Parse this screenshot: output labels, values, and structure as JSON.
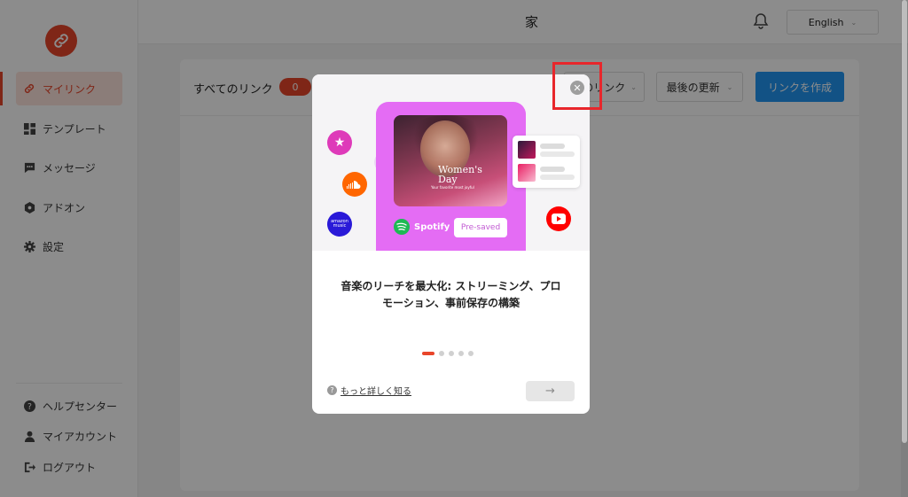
{
  "sidebar": {
    "items": [
      {
        "label": "マイリンク",
        "icon": "link-icon"
      },
      {
        "label": "テンプレート",
        "icon": "grid-icon"
      },
      {
        "label": "メッセージ",
        "icon": "chat-icon"
      },
      {
        "label": "アドオン",
        "icon": "addon-icon"
      },
      {
        "label": "設定",
        "icon": "gear-icon"
      }
    ],
    "bottom_items": [
      {
        "label": "ヘルプセンター",
        "icon": "help-icon"
      },
      {
        "label": "マイアカウント",
        "icon": "user-icon"
      },
      {
        "label": "ログアウト",
        "icon": "logout-icon"
      }
    ]
  },
  "header": {
    "title": "家",
    "language": "English"
  },
  "main": {
    "title": "すべてのリンク",
    "count": "0",
    "filter_type": "のリンク",
    "sort": "最後の更新",
    "create_button": "リンクを作成"
  },
  "modal": {
    "album_title": "Women's Day",
    "album_subtitle": "Your favorite most joyful",
    "spotify_label": "Spotify",
    "presaved_label": "Pre-saved",
    "amazon_label": "amazon music",
    "headline": "音楽のリーチを最大化: ストリーミング、プロモーション、事前保存の構築",
    "learn_more": "もっと詳しく知る",
    "next_arrow": "→",
    "slide_count": 5,
    "active_slide": 1
  },
  "colors": {
    "brand": "#e8452a",
    "primary_button": "#2196f3",
    "hero_pink": "#e46cf4",
    "highlight": "#e8262b"
  }
}
